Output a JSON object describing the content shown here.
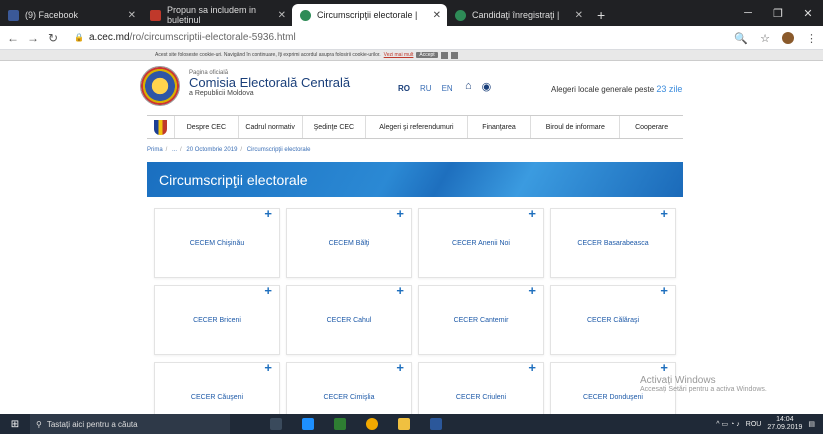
{
  "browser": {
    "tabs": [
      {
        "label": "(9) Facebook",
        "color": "#3b5998",
        "active": false
      },
      {
        "label": "Propun sa includem in buletinul",
        "color": "#c0392b",
        "active": false
      },
      {
        "label": "Circumscripţii electorale |",
        "color": "#2e8b57",
        "active": true
      },
      {
        "label": "Candidaţi înregistraţi |",
        "color": "#2e8b57",
        "active": false
      }
    ],
    "new_tab": "+",
    "url_domain": "a.cec.md",
    "url_path": "/ro/circumscriptii-electorale-5936.html"
  },
  "cookie": {
    "text": "Acest site foloseste cookie-uri. Navigând în continuare, îţi exprimi acordul asupra folosirii cookie-urilor.",
    "more": "Vezi mai mult",
    "accept": "Accept"
  },
  "header": {
    "kicker": "Pagina oficială",
    "title": "Comisia Electorală Centrală",
    "subtitle": "a Republicii Moldova",
    "langs": [
      "RO",
      "RU",
      "EN"
    ],
    "elections_text": "Alegeri locale generale peste",
    "elections_days": "23 zile"
  },
  "menu": [
    "Despre CEC",
    "Cadrul normativ",
    "Şedinţe CEC",
    "Alegeri şi referendumuri",
    "Finanţarea",
    "Biroul de informare",
    "Cooperare"
  ],
  "breadcrumb": [
    "Prima",
    "...",
    "20 Octombrie 2019",
    "Circumscripţii electorale"
  ],
  "page_title": "Circumscripţii electorale",
  "cards": [
    "CECEM Chişinău",
    "CECEM Bălţi",
    "CECER Anenii Noi",
    "CECER Basarabeasca",
    "CECER Briceni",
    "CECER Cahul",
    "CECER Cantemir",
    "CECER Călăraşi",
    "CECER Căuşeni",
    "CECER Cimişlia",
    "CECER Criuleni",
    "CECER Donduşeni"
  ],
  "watermark": {
    "title": "Activați Windows",
    "sub": "Accesați Setări pentru a activa Windows."
  },
  "taskbar": {
    "search": "Tastați aici pentru a căuta",
    "lang": "ROU",
    "time": "14:04",
    "date": "27.09.2019"
  }
}
